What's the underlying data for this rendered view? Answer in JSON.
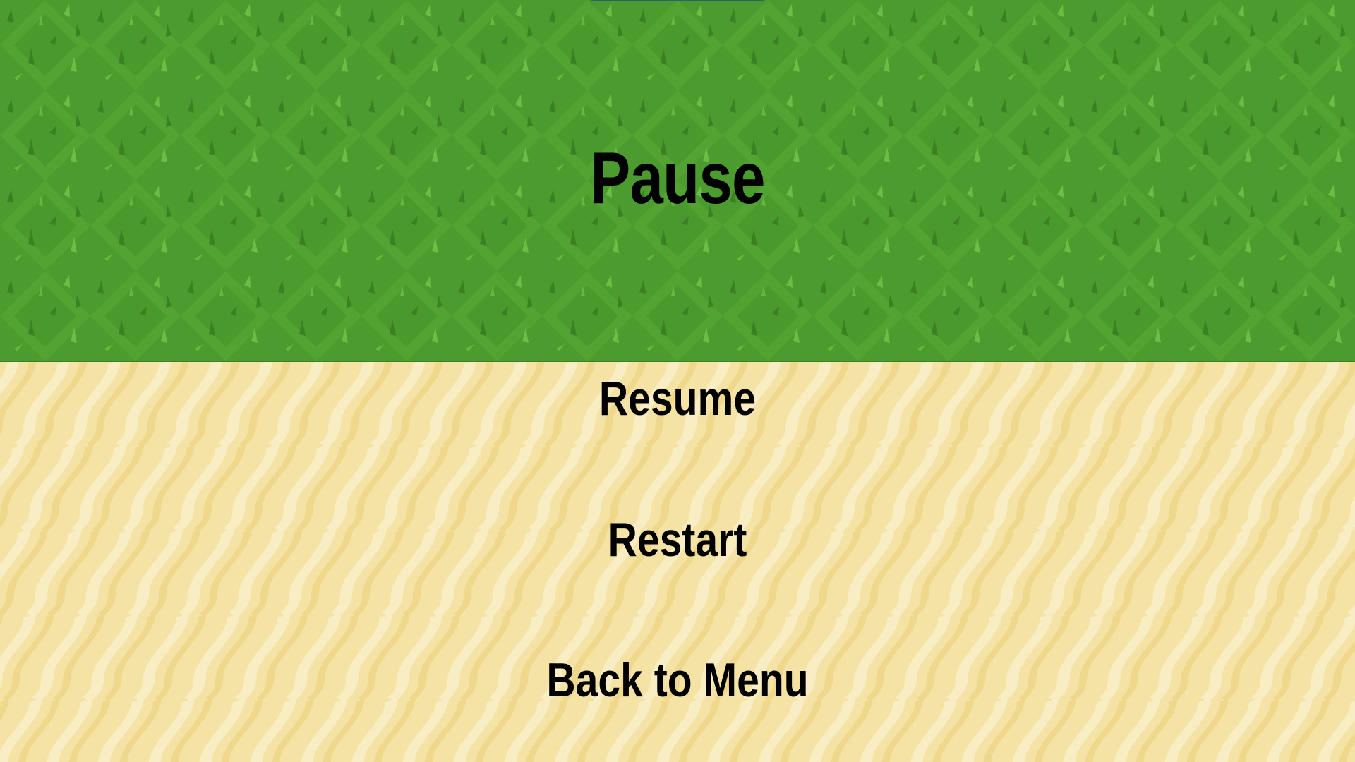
{
  "pause_menu": {
    "title": "Pause",
    "buttons": {
      "resume": "Resume",
      "restart": "Restart",
      "back_to_menu": "Back to Menu"
    }
  },
  "colors": {
    "grass": "#4c9b2e",
    "grass_light": "#5fb23a",
    "grass_dark": "#3e8526",
    "sand": "#f4e3a4",
    "sand_light": "#f9edc4",
    "sand_dark": "#efd88c",
    "text": "#000000"
  }
}
